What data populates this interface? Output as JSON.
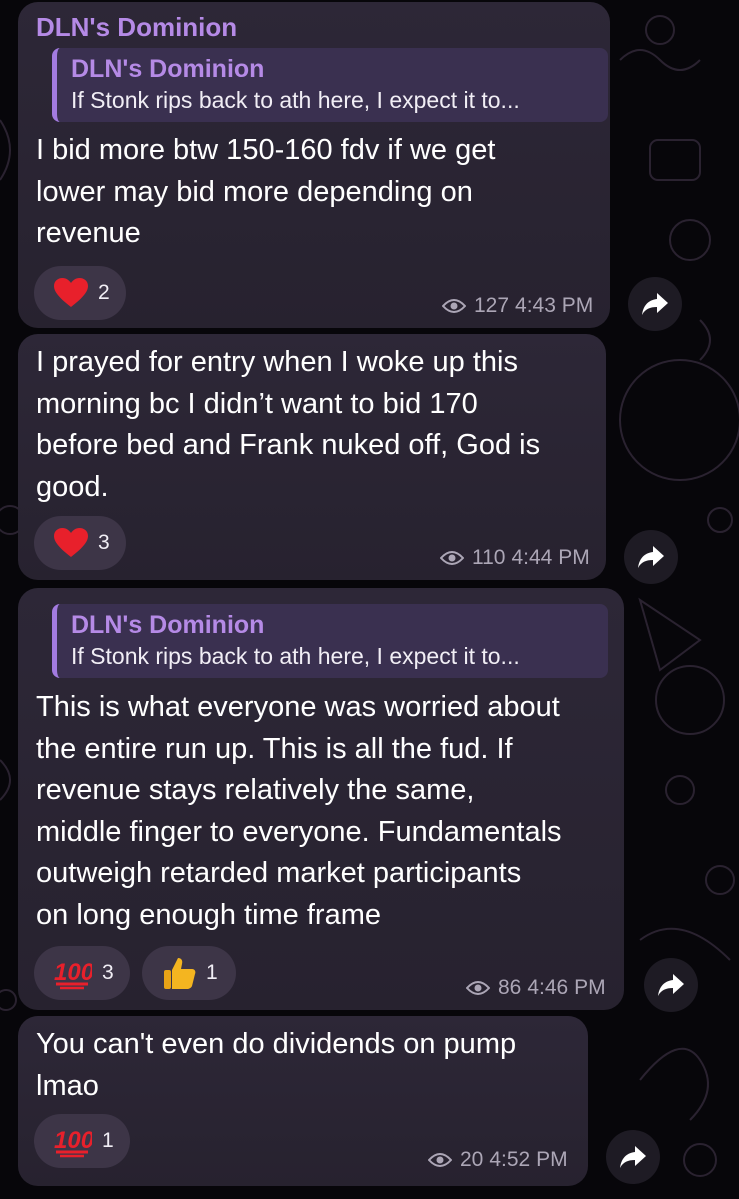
{
  "messages": [
    {
      "sender": "DLN's Dominion",
      "reply": {
        "name": "DLN's Dominion",
        "text": "If Stonk rips back to ath here, I expect it to..."
      },
      "lines": [
        "I bid more btw 150-160 fdv if we get",
        "lower may bid more depending on",
        "revenue"
      ],
      "reactions": [
        {
          "emoji": "heart-icon",
          "count": "2"
        }
      ],
      "views": "127",
      "time": "4:43 PM"
    },
    {
      "lines": [
        "I prayed for entry when I woke up this",
        "morning bc I didn’t want to bid 170",
        "before bed and Frank nuked off, God is",
        "good."
      ],
      "reactions": [
        {
          "emoji": "heart-icon",
          "count": "3"
        }
      ],
      "views": "110",
      "time": "4:44 PM"
    },
    {
      "reply": {
        "name": "DLN's Dominion",
        "text": "If Stonk rips back to ath here, I expect it to..."
      },
      "lines": [
        "This is what everyone was worried about",
        "the entire run up. This is all the fud. If",
        "revenue stays relatively the same,",
        "middle finger to everyone. Fundamentals",
        "outweigh retarded market participants",
        "on long enough time frame"
      ],
      "reactions": [
        {
          "emoji": "hundred-points-icon",
          "count": "3"
        },
        {
          "emoji": "thumbs-up-icon",
          "count": "1"
        }
      ],
      "views": "86",
      "time": "4:46 PM"
    },
    {
      "lines": [
        "You can't even do dividends on pump",
        "lmao"
      ],
      "reactions": [
        {
          "emoji": "hundred-points-icon",
          "count": "1"
        }
      ],
      "views": "20",
      "time": "4:52 PM"
    }
  ],
  "colors": {
    "accent": "#b58ae6",
    "bubble": "#2a2533",
    "reaction": "#3d3547",
    "meta": "#aca6b6"
  }
}
